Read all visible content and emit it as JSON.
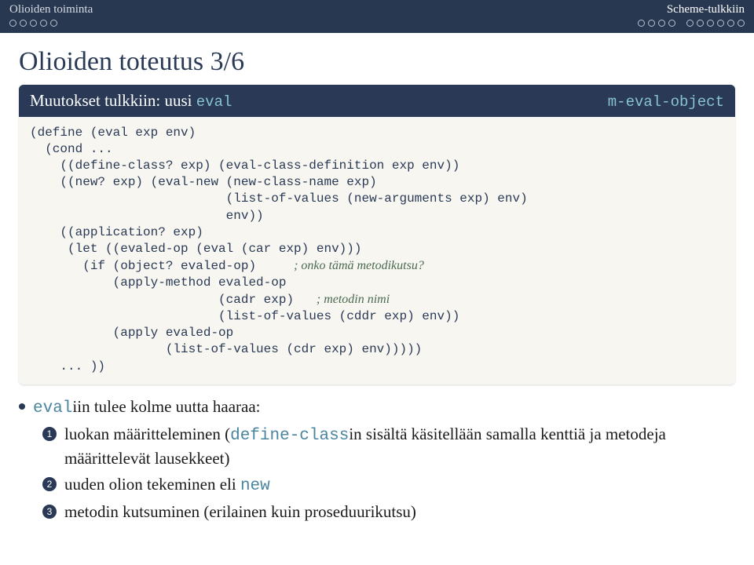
{
  "header": {
    "left": "Olioiden toiminta",
    "right": "Scheme-tulkkiin"
  },
  "title": "Olioiden toteutus 3/6",
  "block": {
    "title": "Muutokset tulkkiin: uusi",
    "title_code": "eval",
    "label": "m-eval-object",
    "code": {
      "l1": "(define (eval exp env)",
      "l2": "  (cond ...",
      "l3": "    ((define-class? exp) (eval-class-definition exp env))",
      "l4": "    ((new? exp) (eval-new (new-class-name exp)",
      "l5": "                          (list-of-values (new-arguments exp) env)",
      "l6": "                          env))",
      "l7": "    ((application? exp)",
      "l8": "     (let ((evaled-op (eval (car exp) env)))",
      "l9a": "       (if (object? evaled-op)     ",
      "l9b": "; onko tämä metodikutsu?",
      "l10": "           (apply-method evaled-op",
      "l11a": "                         (cadr exp)   ",
      "l11b": "; metodin nimi",
      "l12": "                         (list-of-values (cddr exp) env))",
      "l13": "           (apply evaled-op",
      "l14": "                  (list-of-values (cdr exp) env)))))",
      "l15": "    ... ))"
    }
  },
  "bullets": {
    "main_a": "eval",
    "main_b": "iin tulee kolme uutta haaraa:",
    "n1a": "luokan määritteleminen (",
    "n1b": "define-class",
    "n1c": "in sisältä käsitellään samalla kenttiä ja metodeja määrittelevät lausekkeet)",
    "n2a": "uuden olion tekeminen eli ",
    "n2b": "new",
    "n3": "metodin kutsuminen (erilainen kuin proseduurikutsu)"
  }
}
